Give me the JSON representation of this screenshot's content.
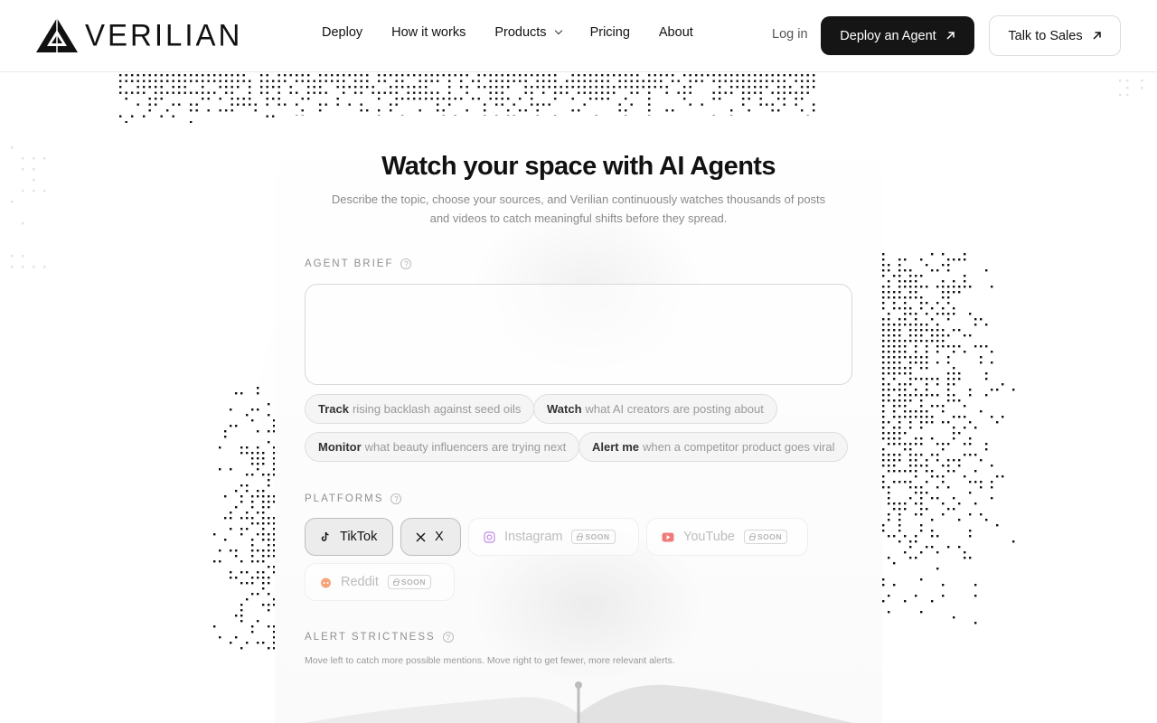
{
  "brand": {
    "name": "VERILIAN"
  },
  "nav": {
    "links": [
      "Deploy",
      "How it works",
      "Products",
      "Pricing",
      "About"
    ],
    "login": "Log in",
    "primary_cta": "Deploy an Agent",
    "secondary_cta": "Talk to Sales"
  },
  "hero": {
    "title": "Watch your space with AI Agents",
    "subtitle_line1": "Describe the topic, choose your sources, and Verilian continuously watches thousands of posts",
    "subtitle_line2": "and videos to catch meaningful shifts before they spread."
  },
  "agent_brief": {
    "label": "AGENT BRIEF",
    "value": "",
    "suggestions": [
      {
        "verb": "Track",
        "rest": "rising backlash against seed oils"
      },
      {
        "verb": "Watch",
        "rest": "what AI creators are posting about"
      },
      {
        "verb": "Monitor",
        "rest": "what beauty influencers are trying next"
      },
      {
        "verb": "Alert me",
        "rest": "when a competitor product goes viral"
      }
    ]
  },
  "platforms": {
    "label": "PLATFORMS",
    "items": [
      {
        "name": "TikTok",
        "icon": "tiktok-icon",
        "state": "selected"
      },
      {
        "name": "X",
        "icon": "x-icon",
        "state": "selected"
      },
      {
        "name": "Instagram",
        "icon": "instagram-icon",
        "state": "soon",
        "badge": "SOON",
        "color": "#c79be8"
      },
      {
        "name": "YouTube",
        "icon": "youtube-icon",
        "state": "soon",
        "badge": "SOON",
        "color": "#ef7a7a"
      },
      {
        "name": "Reddit",
        "icon": "reddit-icon",
        "state": "soon",
        "badge": "SOON",
        "color": "#f4a57a"
      }
    ]
  },
  "alert_strictness": {
    "label": "ALERT STRICTNESS",
    "hint": "Move left to catch more possible mentions. Move right to get fewer, more relevant alerts.",
    "value": 0.5
  },
  "colors": {
    "primary": "#151515",
    "muted": "#8a8a8a",
    "border": "#dedede"
  }
}
